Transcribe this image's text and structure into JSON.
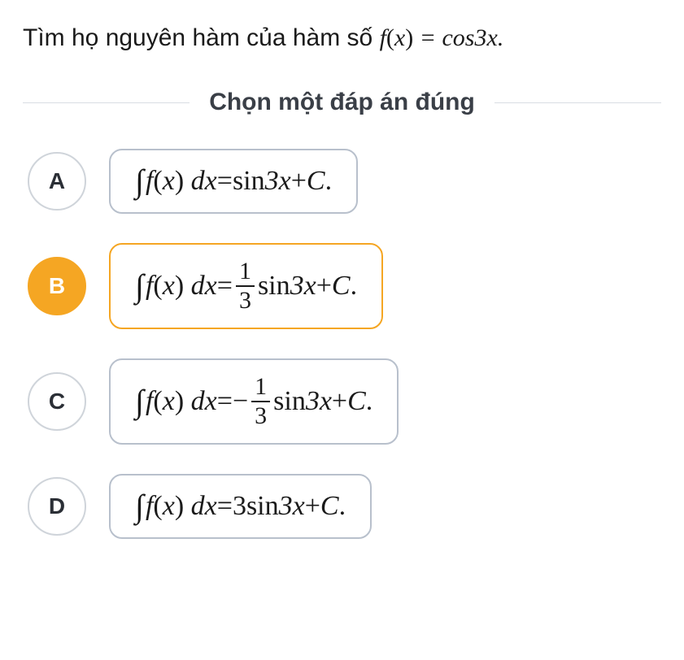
{
  "question": {
    "prefix": "Tìm họ nguyên hàm của hàm số ",
    "func_f": "f",
    "func_open": "(",
    "func_var": "x",
    "func_close": ")",
    "eq": " = ",
    "rhs_cos": "cos",
    "rhs_arg": "3x",
    "period": "."
  },
  "instruction": "Chọn một đáp án đúng",
  "options": {
    "A": {
      "letter": "A",
      "int": "∫",
      "f": "f",
      "open": "(",
      "var": "x",
      "close": ")",
      "dx_d": "d",
      "dx_x": "x",
      "eq": " = ",
      "sin": "sin",
      "arg": "3x",
      "plus": " + ",
      "C": "C",
      "period": "."
    },
    "B": {
      "letter": "B",
      "int": "∫",
      "f": "f",
      "open": "(",
      "var": "x",
      "close": ")",
      "dx_d": "d",
      "dx_x": "x",
      "eq": " = ",
      "frac_num": "1",
      "frac_den": "3",
      "sin": "sin",
      "arg": "3x",
      "plus": " + ",
      "C": "C",
      "period": "."
    },
    "C": {
      "letter": "C",
      "int": "∫",
      "f": "f",
      "open": "(",
      "var": "x",
      "close": ")",
      "dx_d": "d",
      "dx_x": "x",
      "eq": " = ",
      "neg": " − ",
      "frac_num": "1",
      "frac_den": "3",
      "sin": "sin",
      "arg": "3x",
      "plus": " + ",
      "C": "C",
      "period": "."
    },
    "D": {
      "letter": "D",
      "int": "∫",
      "f": "f",
      "open": "(",
      "var": "x",
      "close": ")",
      "dx_d": "d",
      "dx_x": "x",
      "eq": " = ",
      "coef": "3",
      "sin": "sin",
      "arg": "3x",
      "plus": " + ",
      "C": "C",
      "period": "."
    }
  },
  "selected": "B"
}
